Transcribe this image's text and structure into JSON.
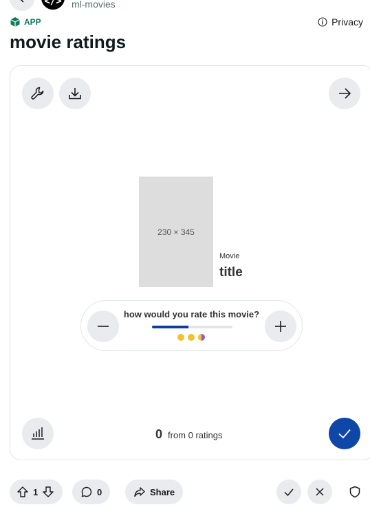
{
  "header": {
    "handle": "ml-movies",
    "app_badge": "APP",
    "privacy_label": "Privacy",
    "page_title": "movie ratings"
  },
  "card": {
    "poster_placeholder": "230 × 345",
    "movie_label": "Movie",
    "movie_title": "title",
    "rating_question": "how would you rate this movie?",
    "rating_level_fraction": 0.45,
    "score_value": "0",
    "score_text": "from 0 ratings"
  },
  "footer": {
    "upvote_count": "1",
    "comment_count": "0",
    "share_label": "Share"
  },
  "colors": {
    "accent": "#0e47a8",
    "app_green": "#0f7b5f",
    "star_yellow": "#f2c12e",
    "star_purple": "#8e5cc2"
  }
}
